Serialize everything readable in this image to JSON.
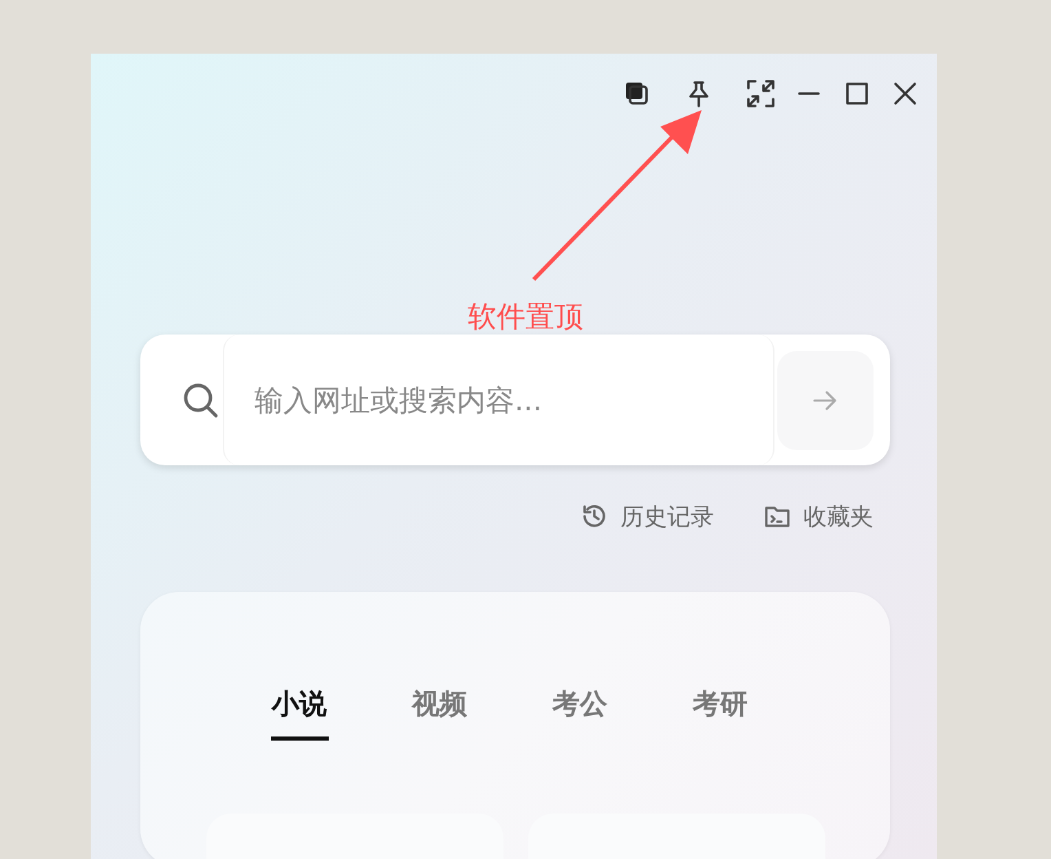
{
  "annotation": {
    "label": "软件置顶"
  },
  "search": {
    "placeholder": "输入网址或搜索内容..."
  },
  "links": [
    {
      "kind": "history",
      "label": "历史记录"
    },
    {
      "kind": "folder",
      "label": "收藏夹"
    }
  ],
  "tabs": [
    {
      "label": "小说",
      "selected": true
    },
    {
      "label": "视频",
      "selected": false
    },
    {
      "label": "考公",
      "selected": false
    },
    {
      "label": "考研",
      "selected": false
    }
  ]
}
